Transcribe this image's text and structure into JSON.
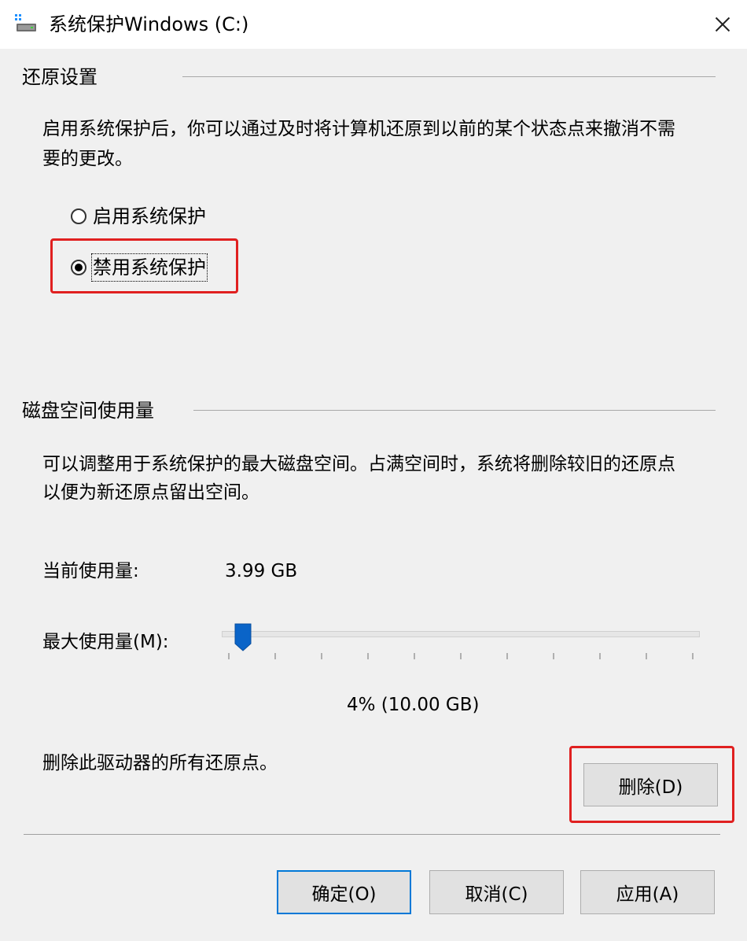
{
  "window": {
    "title": "系统保护Windows (C:)",
    "icon": "drive-icon",
    "close_icon": "close-icon"
  },
  "restore_settings": {
    "heading": "还原设置",
    "description_line1": "启用系统保护后，你可以通过及时将计算机还原到以前的某个状态点来撤消不需",
    "description_line2": "要的更改。",
    "options": [
      {
        "label": "启用系统保护",
        "checked": false
      },
      {
        "label": "禁用系统保护",
        "checked": true
      }
    ]
  },
  "disk_space": {
    "heading": "磁盘空间使用量",
    "description_line1": "可以调整用于系统保护的最大磁盘空间。占满空间时，系统将删除较旧的还原点",
    "description_line2": "以便为新还原点留出空间。",
    "current_usage_label": "当前使用量:",
    "current_usage_value": "3.99 GB",
    "max_usage_label": "最大使用量(M):",
    "max_usage_value_text": "4% (10.00 GB)",
    "max_usage_percent": 4,
    "delete_text": "删除此驱动器的所有还原点。",
    "delete_button": "删除(D)"
  },
  "buttons": {
    "ok": "确定(O)",
    "cancel": "取消(C)",
    "apply": "应用(A)"
  },
  "colors": {
    "highlight_border": "#e02020",
    "slider_thumb": "#0a64c8",
    "default_button_border": "#0078d7"
  }
}
